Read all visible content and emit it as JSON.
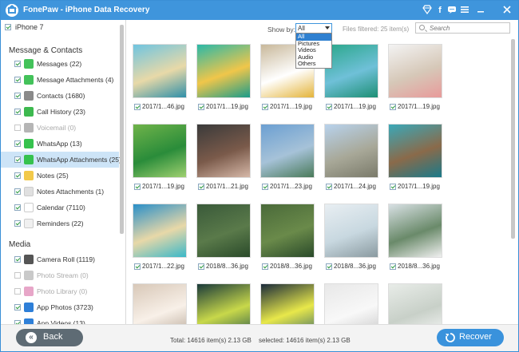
{
  "window": {
    "title": "FonePaw - iPhone Data Recovery"
  },
  "titlebar_icons": [
    "diamond-icon",
    "facebook-icon",
    "chat-icon",
    "menu-icon",
    "minimize-icon",
    "close-icon"
  ],
  "sidebar": {
    "device": "iPhone 7",
    "sections": [
      {
        "title": "Message & Contacts",
        "items": [
          {
            "label": "Messages (22)",
            "icon": "messages-icon",
            "color": "#43c25a",
            "checked": true,
            "enabled": true
          },
          {
            "label": "Message Attachments (4)",
            "icon": "message-attachments-icon",
            "color": "#43c25a",
            "checked": true,
            "enabled": true
          },
          {
            "label": "Contacts (1680)",
            "icon": "contacts-icon",
            "color": "#8a8a8a",
            "checked": true,
            "enabled": true
          },
          {
            "label": "Call History (23)",
            "icon": "call-history-icon",
            "color": "#3db94f",
            "checked": true,
            "enabled": true
          },
          {
            "label": "Voicemail (0)",
            "icon": "voicemail-icon",
            "color": "#b5b5b5",
            "checked": false,
            "enabled": false
          },
          {
            "label": "WhatsApp (13)",
            "icon": "whatsapp-icon",
            "color": "#36c24e",
            "checked": true,
            "enabled": true
          },
          {
            "label": "WhatsApp Attachments (25)",
            "icon": "whatsapp-attachments-icon",
            "color": "#36c24e",
            "checked": true,
            "enabled": true,
            "selected": true
          },
          {
            "label": "Notes (25)",
            "icon": "notes-icon",
            "color": "#f2c94a",
            "checked": true,
            "enabled": true
          },
          {
            "label": "Notes Attachments (1)",
            "icon": "notes-attachments-icon",
            "color": "#e0e0e0",
            "checked": true,
            "enabled": true
          },
          {
            "label": "Calendar (7110)",
            "icon": "calendar-icon",
            "color": "#ffffff",
            "checked": true,
            "enabled": true
          },
          {
            "label": "Reminders (22)",
            "icon": "reminders-icon",
            "color": "#f0f0f0",
            "checked": true,
            "enabled": true
          }
        ]
      },
      {
        "title": "Media",
        "items": [
          {
            "label": "Camera Roll (1119)",
            "icon": "camera-roll-icon",
            "color": "#555555",
            "checked": true,
            "enabled": true
          },
          {
            "label": "Photo Stream (0)",
            "icon": "photo-stream-icon",
            "color": "#c9c9c9",
            "checked": false,
            "enabled": false
          },
          {
            "label": "Photo Library (0)",
            "icon": "photo-library-icon",
            "color": "#e7a6c8",
            "checked": false,
            "enabled": false
          },
          {
            "label": "App Photos (3723)",
            "icon": "app-photos-icon",
            "color": "#2e7fd8",
            "checked": true,
            "enabled": true
          },
          {
            "label": "App Videos (13)",
            "icon": "app-videos-icon",
            "color": "#2e7fd8",
            "checked": true,
            "enabled": true
          }
        ]
      }
    ]
  },
  "toolbar": {
    "show_by_label": "Show by:",
    "show_by_value": "All",
    "show_by_options": [
      "All",
      "Pictures",
      "Videos",
      "Audio",
      "Others"
    ],
    "files_filtered": "Files filtered: 25 item(s)",
    "search_placeholder": "Search"
  },
  "grid": {
    "items": [
      {
        "label": "2017/1...46.jpg",
        "checked": true,
        "palette": [
          "#6fc4e0",
          "#e8d9a8",
          "#2f8fa8"
        ]
      },
      {
        "label": "2017/1...19.jpg",
        "checked": true,
        "palette": [
          "#2ab8a8",
          "#f0c64a",
          "#1a9c8a"
        ]
      },
      {
        "label": "2017/1...19.jpg",
        "checked": true,
        "palette": [
          "#c8b89a",
          "#ffffff",
          "#e4b43a"
        ]
      },
      {
        "label": "2017/1...19.jpg",
        "checked": true,
        "palette": [
          "#2aa78a",
          "#6fc0d8",
          "#1d8f74"
        ]
      },
      {
        "label": "2017/1...19.jpg",
        "checked": true,
        "palette": [
          "#f3f3f3",
          "#d6c8b8",
          "#e89a9a"
        ]
      },
      {
        "label": "2017/1...19.jpg",
        "checked": true,
        "palette": [
          "#6fb34a",
          "#2a8c3a",
          "#9fd070"
        ]
      },
      {
        "label": "2017/1...21.jpg",
        "checked": true,
        "palette": [
          "#3a3a3a",
          "#7a5a4a",
          "#d6b8a8"
        ]
      },
      {
        "label": "2017/1...23.jpg",
        "checked": true,
        "palette": [
          "#6b9fd2",
          "#a6c2d8",
          "#4a7a5a"
        ]
      },
      {
        "label": "2017/1...24.jpg",
        "checked": true,
        "palette": [
          "#b8d2ec",
          "#a8a898",
          "#7a7a6a"
        ]
      },
      {
        "label": "2017/1...19.jpg",
        "checked": true,
        "palette": [
          "#3aa8b8",
          "#8a6a4a",
          "#1a7a8a"
        ]
      },
      {
        "label": "2017/1...22.jpg",
        "checked": true,
        "palette": [
          "#2a8fc8",
          "#e8d8a8",
          "#3ab8c8"
        ]
      },
      {
        "label": "2018/8...36.jpg",
        "checked": true,
        "palette": [
          "#3a5a3a",
          "#5a7a4a",
          "#2a4a2a"
        ]
      },
      {
        "label": "2018/8...36.jpg",
        "checked": true,
        "palette": [
          "#4a6a3a",
          "#6a8a4a",
          "#2a4a2a"
        ]
      },
      {
        "label": "2018/8...36.jpg",
        "checked": true,
        "palette": [
          "#e8eef2",
          "#c8d8e0",
          "#8a9aa0"
        ]
      },
      {
        "label": "2018/8...36.jpg",
        "checked": true,
        "palette": [
          "#d8e0e4",
          "#6a8a6a",
          "#f0f0f0"
        ]
      },
      {
        "label": "",
        "checked": true,
        "palette": [
          "#d8c8b8",
          "#f8f0e8",
          "#b8a898"
        ]
      },
      {
        "label": "",
        "checked": true,
        "palette": [
          "#1a3a3a",
          "#c8d84a",
          "#2a5a4a"
        ]
      },
      {
        "label": "",
        "checked": true,
        "palette": [
          "#1a2a3a",
          "#e8e84a",
          "#3a6a6a"
        ]
      },
      {
        "label": "",
        "checked": true,
        "palette": [
          "#e8e8e8",
          "#f8f8f8",
          "#c8c8c8"
        ]
      },
      {
        "label": "",
        "checked": true,
        "palette": [
          "#e8ece8",
          "#c8d0c8",
          "#f8f8f8"
        ]
      }
    ]
  },
  "status": {
    "total": "Total: 14616 item(s) 2.13 GB",
    "selected": "selected: 14616 item(s) 2.13 GB"
  },
  "buttons": {
    "back": "Back",
    "recover": "Recover"
  },
  "colors": {
    "accent": "#3f95dc",
    "selected_row": "#cde4f7",
    "back_button": "#5e6b74",
    "recover_button": "#3a92dc"
  }
}
